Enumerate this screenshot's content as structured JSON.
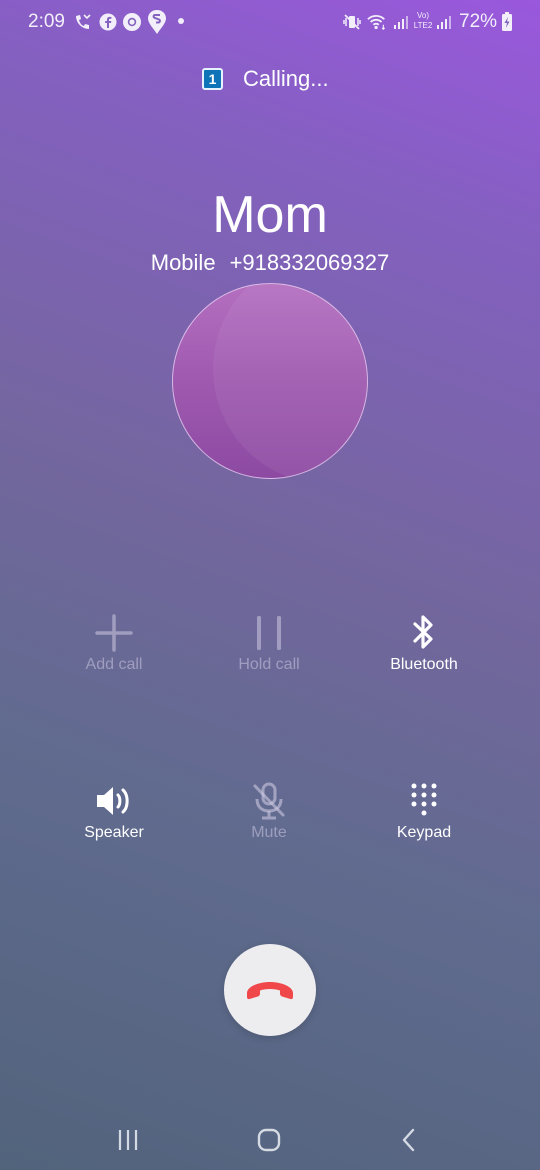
{
  "status_bar": {
    "time": "2:09",
    "battery_percent": "72%",
    "left_icons": [
      "missed-call-icon",
      "facebook-icon",
      "chrome-icon",
      "swiggy-icon"
    ],
    "right_icons": [
      "vibrate-mute-icon",
      "wifi-icon",
      "signal-icon",
      "volte-lte2-icon",
      "signal-icon",
      "battery-charging-icon"
    ],
    "volte_label_top": "Vo)",
    "volte_label_bottom": "LTE2"
  },
  "call": {
    "sim_label": "1",
    "status": "Calling...",
    "contact_name": "Mom",
    "number_type": "Mobile",
    "phone_number": "+918332069327"
  },
  "controls": {
    "add_call": {
      "label": "Add call",
      "icon": "plus-icon",
      "enabled": false
    },
    "hold_call": {
      "label": "Hold call",
      "icon": "pause-icon",
      "enabled": false
    },
    "bluetooth": {
      "label": "Bluetooth",
      "icon": "bluetooth-icon",
      "enabled": true
    },
    "speaker": {
      "label": "Speaker",
      "icon": "speaker-icon",
      "enabled": true
    },
    "mute": {
      "label": "Mute",
      "icon": "mic-off-icon",
      "enabled": false
    },
    "keypad": {
      "label": "Keypad",
      "icon": "keypad-icon",
      "enabled": true
    }
  },
  "end_call": {
    "icon": "end-call-icon"
  },
  "navigation": {
    "recents": "recents-icon",
    "home": "home-icon",
    "back": "back-icon"
  },
  "colors": {
    "end_call_red": "#f0474b",
    "gradient_top": "#9a58dd",
    "gradient_bottom": "#52637c"
  }
}
